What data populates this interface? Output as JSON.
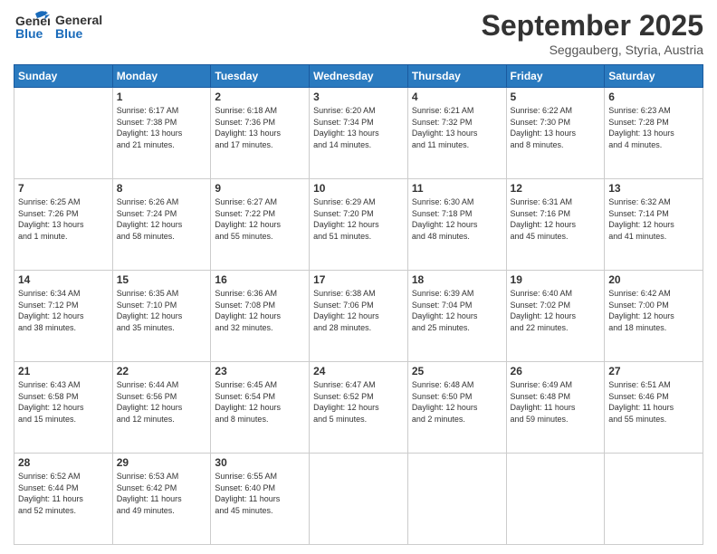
{
  "header": {
    "logo_line1": "General",
    "logo_line2": "Blue",
    "month": "September 2025",
    "location": "Seggauberg, Styria, Austria"
  },
  "days_of_week": [
    "Sunday",
    "Monday",
    "Tuesday",
    "Wednesday",
    "Thursday",
    "Friday",
    "Saturday"
  ],
  "weeks": [
    [
      {
        "day": "",
        "info": ""
      },
      {
        "day": "1",
        "info": "Sunrise: 6:17 AM\nSunset: 7:38 PM\nDaylight: 13 hours\nand 21 minutes."
      },
      {
        "day": "2",
        "info": "Sunrise: 6:18 AM\nSunset: 7:36 PM\nDaylight: 13 hours\nand 17 minutes."
      },
      {
        "day": "3",
        "info": "Sunrise: 6:20 AM\nSunset: 7:34 PM\nDaylight: 13 hours\nand 14 minutes."
      },
      {
        "day": "4",
        "info": "Sunrise: 6:21 AM\nSunset: 7:32 PM\nDaylight: 13 hours\nand 11 minutes."
      },
      {
        "day": "5",
        "info": "Sunrise: 6:22 AM\nSunset: 7:30 PM\nDaylight: 13 hours\nand 8 minutes."
      },
      {
        "day": "6",
        "info": "Sunrise: 6:23 AM\nSunset: 7:28 PM\nDaylight: 13 hours\nand 4 minutes."
      }
    ],
    [
      {
        "day": "7",
        "info": "Sunrise: 6:25 AM\nSunset: 7:26 PM\nDaylight: 13 hours\nand 1 minute."
      },
      {
        "day": "8",
        "info": "Sunrise: 6:26 AM\nSunset: 7:24 PM\nDaylight: 12 hours\nand 58 minutes."
      },
      {
        "day": "9",
        "info": "Sunrise: 6:27 AM\nSunset: 7:22 PM\nDaylight: 12 hours\nand 55 minutes."
      },
      {
        "day": "10",
        "info": "Sunrise: 6:29 AM\nSunset: 7:20 PM\nDaylight: 12 hours\nand 51 minutes."
      },
      {
        "day": "11",
        "info": "Sunrise: 6:30 AM\nSunset: 7:18 PM\nDaylight: 12 hours\nand 48 minutes."
      },
      {
        "day": "12",
        "info": "Sunrise: 6:31 AM\nSunset: 7:16 PM\nDaylight: 12 hours\nand 45 minutes."
      },
      {
        "day": "13",
        "info": "Sunrise: 6:32 AM\nSunset: 7:14 PM\nDaylight: 12 hours\nand 41 minutes."
      }
    ],
    [
      {
        "day": "14",
        "info": "Sunrise: 6:34 AM\nSunset: 7:12 PM\nDaylight: 12 hours\nand 38 minutes."
      },
      {
        "day": "15",
        "info": "Sunrise: 6:35 AM\nSunset: 7:10 PM\nDaylight: 12 hours\nand 35 minutes."
      },
      {
        "day": "16",
        "info": "Sunrise: 6:36 AM\nSunset: 7:08 PM\nDaylight: 12 hours\nand 32 minutes."
      },
      {
        "day": "17",
        "info": "Sunrise: 6:38 AM\nSunset: 7:06 PM\nDaylight: 12 hours\nand 28 minutes."
      },
      {
        "day": "18",
        "info": "Sunrise: 6:39 AM\nSunset: 7:04 PM\nDaylight: 12 hours\nand 25 minutes."
      },
      {
        "day": "19",
        "info": "Sunrise: 6:40 AM\nSunset: 7:02 PM\nDaylight: 12 hours\nand 22 minutes."
      },
      {
        "day": "20",
        "info": "Sunrise: 6:42 AM\nSunset: 7:00 PM\nDaylight: 12 hours\nand 18 minutes."
      }
    ],
    [
      {
        "day": "21",
        "info": "Sunrise: 6:43 AM\nSunset: 6:58 PM\nDaylight: 12 hours\nand 15 minutes."
      },
      {
        "day": "22",
        "info": "Sunrise: 6:44 AM\nSunset: 6:56 PM\nDaylight: 12 hours\nand 12 minutes."
      },
      {
        "day": "23",
        "info": "Sunrise: 6:45 AM\nSunset: 6:54 PM\nDaylight: 12 hours\nand 8 minutes."
      },
      {
        "day": "24",
        "info": "Sunrise: 6:47 AM\nSunset: 6:52 PM\nDaylight: 12 hours\nand 5 minutes."
      },
      {
        "day": "25",
        "info": "Sunrise: 6:48 AM\nSunset: 6:50 PM\nDaylight: 12 hours\nand 2 minutes."
      },
      {
        "day": "26",
        "info": "Sunrise: 6:49 AM\nSunset: 6:48 PM\nDaylight: 11 hours\nand 59 minutes."
      },
      {
        "day": "27",
        "info": "Sunrise: 6:51 AM\nSunset: 6:46 PM\nDaylight: 11 hours\nand 55 minutes."
      }
    ],
    [
      {
        "day": "28",
        "info": "Sunrise: 6:52 AM\nSunset: 6:44 PM\nDaylight: 11 hours\nand 52 minutes."
      },
      {
        "day": "29",
        "info": "Sunrise: 6:53 AM\nSunset: 6:42 PM\nDaylight: 11 hours\nand 49 minutes."
      },
      {
        "day": "30",
        "info": "Sunrise: 6:55 AM\nSunset: 6:40 PM\nDaylight: 11 hours\nand 45 minutes."
      },
      {
        "day": "",
        "info": ""
      },
      {
        "day": "",
        "info": ""
      },
      {
        "day": "",
        "info": ""
      },
      {
        "day": "",
        "info": ""
      }
    ]
  ]
}
